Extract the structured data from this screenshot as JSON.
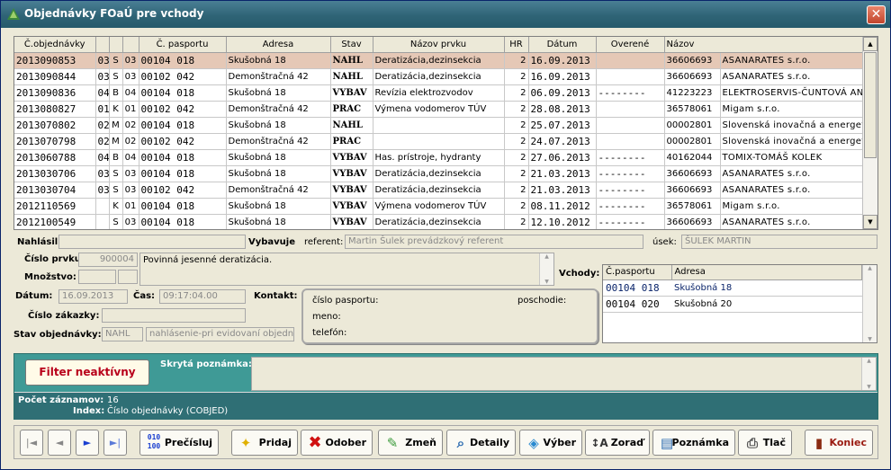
{
  "window": {
    "title": "Objednávky FOaÚ pre vchody",
    "close": "✕"
  },
  "grid": {
    "headers": [
      "Č.objednávky",
      "",
      "",
      "",
      "Č. pasportu",
      "Adresa",
      "Stav",
      "Názov prvku",
      "HR",
      "Dátum",
      "Overené",
      "Názov"
    ],
    "rows": [
      [
        "2013090853",
        "03",
        "S",
        "03",
        "00104 018",
        "Skušobná 18",
        "NAHL",
        "Deratizácia,dezinsekcia",
        "2",
        "16.09.2013",
        "",
        "36606693",
        "ASANARATES s.r.o."
      ],
      [
        "2013090844",
        "03",
        "S",
        "03",
        "00102 042",
        "Demonštračná 42",
        "NAHL",
        "Deratizácia,dezinsekcia",
        "2",
        "16.09.2013",
        "",
        "36606693",
        "ASANARATES s.r.o."
      ],
      [
        "2013090836",
        "04",
        "B",
        "04",
        "00104 018",
        "Skušobná 18",
        "VYBAV",
        "Revízia elektrozvodov",
        "2",
        "06.09.2013",
        "--------",
        "41223223",
        "ELEKTROSERVIS-ČUNTOVÁ ANNA"
      ],
      [
        "2013080827",
        "01",
        "K",
        "01",
        "00102 042",
        "Demonštračná 42",
        "PRAC",
        "Výmena vodomerov TÚV",
        "2",
        "28.08.2013",
        "",
        "36578061",
        "Migam s.r.o."
      ],
      [
        "2013070802",
        "02",
        "M",
        "02",
        "00104 018",
        "Skušobná 18",
        "NAHL",
        "",
        "2",
        "25.07.2013",
        "",
        "00002801",
        "Slovenská inovačná a energetická a"
      ],
      [
        "2013070798",
        "02",
        "M",
        "02",
        "00102 042",
        "Demonštračná 42",
        "PRAC",
        "",
        "2",
        "24.07.2013",
        "",
        "00002801",
        "Slovenská inovačná a energetická a"
      ],
      [
        "2013060788",
        "04",
        "B",
        "04",
        "00104 018",
        "Skušobná 18",
        "VYBAV",
        "Has. prístroje, hydranty",
        "2",
        "27.06.2013",
        "--------",
        "40162044",
        "TOMIX-TOMÁŠ KOLEK"
      ],
      [
        "2013030706",
        "03",
        "S",
        "03",
        "00104 018",
        "Skušobná 18",
        "VYBAV",
        "Deratizácia,dezinsekcia",
        "2",
        "21.03.2013",
        "--------",
        "36606693",
        "ASANARATES s.r.o."
      ],
      [
        "2013030704",
        "03",
        "S",
        "03",
        "00102 042",
        "Demonštračná 42",
        "VYBAV",
        "Deratizácia,dezinsekcia",
        "2",
        "21.03.2013",
        "--------",
        "36606693",
        "ASANARATES s.r.o."
      ],
      [
        "2012110569",
        "",
        "K",
        "01",
        "00104 018",
        "Skušobná 18",
        "VYBAV",
        "Výmena vodomerov TÚV",
        "2",
        "08.11.2012",
        "--------",
        "36578061",
        "Migam s.r.o."
      ],
      [
        "2012100549",
        "",
        "S",
        "03",
        "00104 018",
        "Skušobná 18",
        "VYBAV",
        "Deratizácia,dezinsekcia",
        "2",
        "12.10.2012",
        "--------",
        "36606693",
        "ASANARATES s.r.o."
      ]
    ]
  },
  "form": {
    "nahlasil_label": "Nahlásil:",
    "vybavuje_label": "Vybavuje",
    "referent_label": "referent:",
    "referent_value": "Martin Šulek prevádzkový referent",
    "usek_label": "úsek:",
    "usek_value": "ŠULEK MARTIN",
    "cislo_prvku_label": "Číslo prvku:",
    "cislo_prvku_value": "900004",
    "mnozstvo_label": "Množstvo:",
    "poznamka_value": "Povinná jesenné deratizácia.",
    "vchody_label": "Vchody:",
    "datum_label": "Dátum:",
    "datum_value": "16.09.2013",
    "cas_label": "Čas:",
    "cas_value": "09:17:04.00",
    "kontakt_label": "Kontakt:",
    "cislo_zakazky_label": "Číslo zákazky:",
    "stav_obj_label": "Stav objednávky:",
    "stav_obj_code": "NAHL",
    "stav_obj_text": "nahlásenie-pri evidovaní objednáv",
    "contact_pasport": "číslo pasportu:",
    "contact_poschodie": "poschodie:",
    "contact_meno": "meno:",
    "contact_telefon": "telefón:"
  },
  "vchody": {
    "headers": [
      "Č.pasportu",
      "Adresa"
    ],
    "rows": [
      [
        "00104 018",
        "Skušobná 18"
      ],
      [
        "00104 020",
        "Skušobná 20"
      ]
    ]
  },
  "panel": {
    "filter_button": "Filter neaktívny",
    "skryta_label": "Skrytá poznámka:",
    "pocet_label": "Počet záznamov:",
    "pocet_value": "16",
    "index_label": "Index:",
    "index_value": "Číslo objednávky (COBJED)"
  },
  "toolbar": {
    "nav_first": "|◄",
    "nav_prev": "◄",
    "nav_next": "►",
    "nav_last": "►|",
    "precisluj": "Prečísluj",
    "pridaj": "Pridaj",
    "odober": "Odober",
    "zmen": "Zmeň",
    "detaily": "Detaily",
    "vyber": "Výber",
    "zorad": "Zoraď",
    "poznamka": "Poznámka",
    "tlac": "Tlač",
    "koniec": "Koniec"
  },
  "colors": {
    "title_bar": "#2f6476",
    "selected_row": "#e5c8b6",
    "teal_panel": "#3f9a96",
    "info_bar": "#2f6f75",
    "filter_text": "#b8001a"
  }
}
